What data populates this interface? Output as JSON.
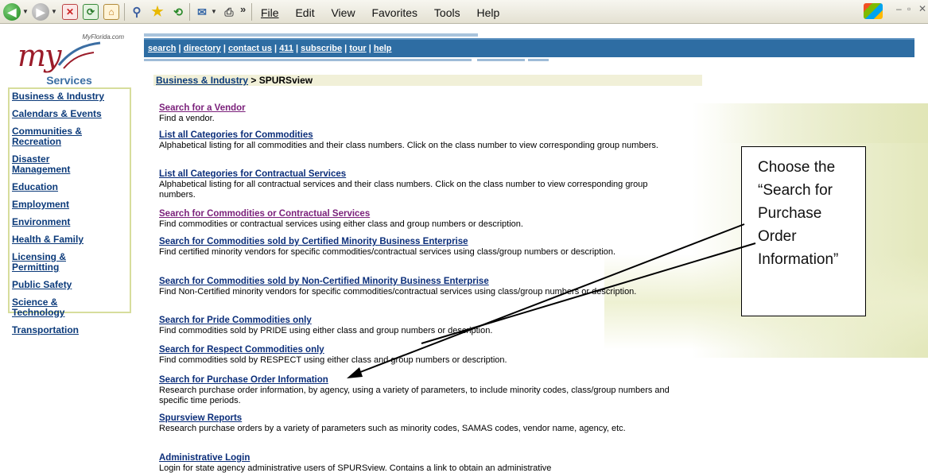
{
  "toolbar": {
    "menus": [
      "File",
      "Edit",
      "View",
      "Favorites",
      "Tools",
      "Help"
    ],
    "chevron": "»"
  },
  "logo": {
    "site": "MyFlorida.com",
    "text": "my"
  },
  "linkbar": {
    "links": [
      "search",
      "directory",
      "contact us",
      "411",
      "subscribe",
      "tour",
      "help"
    ]
  },
  "sidebar": {
    "header": "Services",
    "items": [
      "Business & Industry",
      "Calendars & Events",
      "Communities & Recreation",
      "Disaster Management",
      "Education",
      "Employment",
      "Environment",
      "Health & Family",
      "Licensing & Permitting",
      "Public Safety",
      "Science & Technology",
      "Transportation"
    ]
  },
  "breadcrumb": {
    "parent": "Business & Industry",
    "sep": " > ",
    "current": "SPURSview"
  },
  "items": [
    {
      "title": "Search for a Vendor",
      "desc": "Find a vendor.",
      "visited": true
    },
    {
      "title": "List all Categories for Commodities",
      "desc": "Alphabetical listing for all commodities and their class numbers. Click on the class number to view corresponding group numbers.",
      "visited": false
    },
    {
      "title": "List all Categories for Contractual Services",
      "desc": "Alphabetical listing for all contractual services and their class numbers. Click on the class number to view corresponding group numbers.",
      "visited": false
    },
    {
      "title": "Search for Commodities or Contractual Services",
      "desc": "Find commodities or contractual services using either class and group numbers or description.",
      "visited": true
    },
    {
      "title": "Search for Commodities sold by Certified Minority Business Enterprise",
      "desc": "Find certified minority vendors for specific commodities/contractual services using class/group numbers or description.",
      "visited": false
    },
    {
      "title": "Search for Commodities sold by Non-Certified Minority Business Enterprise",
      "desc": "Find Non-Certified minority vendors for specific commodities/contractual services using class/group numbers or description.",
      "visited": false
    },
    {
      "title": "Search for Pride Commodities only",
      "desc": "Find commodities sold by PRIDE using either class and group numbers or description.",
      "visited": false
    },
    {
      "title": "Search for Respect Commodities only",
      "desc": "Find commodities sold by RESPECT using either class and group numbers or description.",
      "visited": false
    },
    {
      "title": "Search for Purchase Order Information",
      "desc": "Research purchase order information, by agency, using a variety of parameters, to include minority codes, class/group numbers and specific time periods.",
      "visited": false
    },
    {
      "title": "Spursview Reports",
      "desc": "Research purchase orders by a variety of parameters such as minority codes, SAMAS codes, vendor name, agency, etc.",
      "visited": false
    },
    {
      "title": "Administrative Login",
      "desc": "Login for state agency administrative users of SPURSview. Contains a link to obtain an administrative",
      "visited": false
    }
  ],
  "callout": {
    "lines": [
      "Choose the",
      "“Search for",
      "Purchase",
      "Order",
      "Information”"
    ]
  },
  "colors": {
    "linkbar": "#2e6da3",
    "link": "#0b2e7a",
    "visited": "#7a1f7a",
    "logo": "#9b1c2a"
  }
}
